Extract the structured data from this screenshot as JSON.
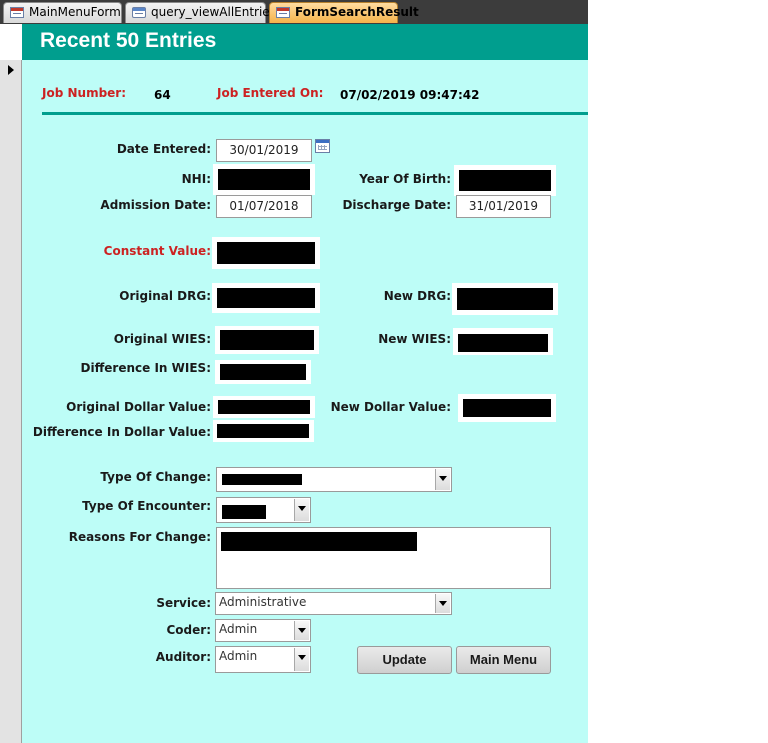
{
  "tabs": [
    {
      "label": "MainMenuForm",
      "active": false
    },
    {
      "label": "query_viewAllEntries",
      "active": false
    },
    {
      "label": "FormSearchResult",
      "active": true
    }
  ],
  "form": {
    "title": "Recent 50 Entries",
    "job_number_label": "Job Number:",
    "job_number": "64",
    "job_entered_label": "Job Entered On:",
    "job_entered": "07/02/2019 09:47:42"
  },
  "fields": {
    "date_entered": {
      "label": "Date Entered:",
      "value": "30/01/2019"
    },
    "nhi": {
      "label": "NHI:"
    },
    "year_of_birth": {
      "label": "Year Of Birth:"
    },
    "admission_date": {
      "label": "Admission Date:",
      "value": "01/07/2018"
    },
    "discharge_date": {
      "label": "Discharge Date:",
      "value": "31/01/2019"
    },
    "constant_value": {
      "label": "Constant Value:"
    },
    "original_drg": {
      "label": "Original DRG:"
    },
    "new_drg": {
      "label": "New DRG:"
    },
    "original_wies": {
      "label": "Original WIES:"
    },
    "new_wies": {
      "label": "New WIES:"
    },
    "difference_wies": {
      "label": "Difference In WIES:"
    },
    "original_dollar": {
      "label": "Original Dollar Value:"
    },
    "new_dollar": {
      "label": "New Dollar Value:"
    },
    "difference_dollar": {
      "label": "Difference In Dollar Value:"
    },
    "type_of_change": {
      "label": "Type Of Change:"
    },
    "type_of_encounter": {
      "label": "Type Of Encounter:"
    },
    "reasons_for_change": {
      "label": "Reasons For Change:"
    },
    "service": {
      "label": "Service:",
      "value": "Administrative"
    },
    "coder": {
      "label": "Coder:",
      "value": "Admin"
    },
    "auditor": {
      "label": "Auditor:",
      "value": "Admin"
    }
  },
  "buttons": {
    "update": "Update",
    "main_menu": "Main Menu"
  },
  "colors": {
    "header": "#009e8e",
    "form_background": "#bdfdf7",
    "label_red": "#cc2222"
  }
}
